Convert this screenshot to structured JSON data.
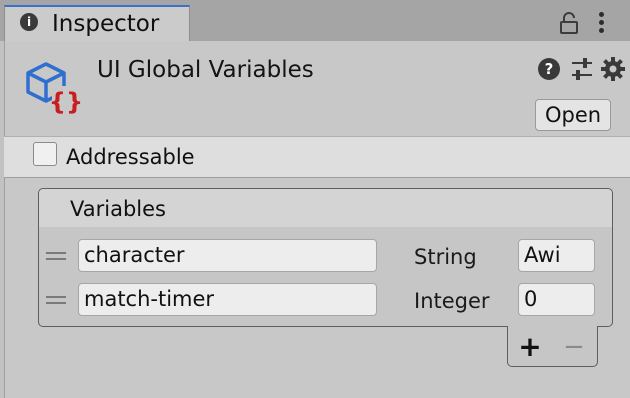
{
  "window": {
    "tab_title": "Inspector",
    "tab_info_glyph": "i"
  },
  "header": {
    "asset_title": "UI Global Variables",
    "help_glyph": "?",
    "open_button": "Open",
    "icons": [
      "global-variables-icon",
      "help-icon",
      "preset-sliders-icon",
      "gear-icon",
      "lock-icon",
      "kebab-menu-icon"
    ]
  },
  "addressable": {
    "label": "Addressable",
    "checked": false
  },
  "variables": {
    "header": "Variables",
    "rows": [
      {
        "name": "character",
        "type": "String",
        "value": "Awi"
      },
      {
        "name": "match-timer",
        "type": "Integer",
        "value": "0"
      }
    ],
    "add_glyph": "+",
    "remove_glyph": "−"
  },
  "colors": {
    "tab_accent": "#3a72c9",
    "icon_blue": "#2f6fcf",
    "icon_red": "#c81e1e"
  }
}
